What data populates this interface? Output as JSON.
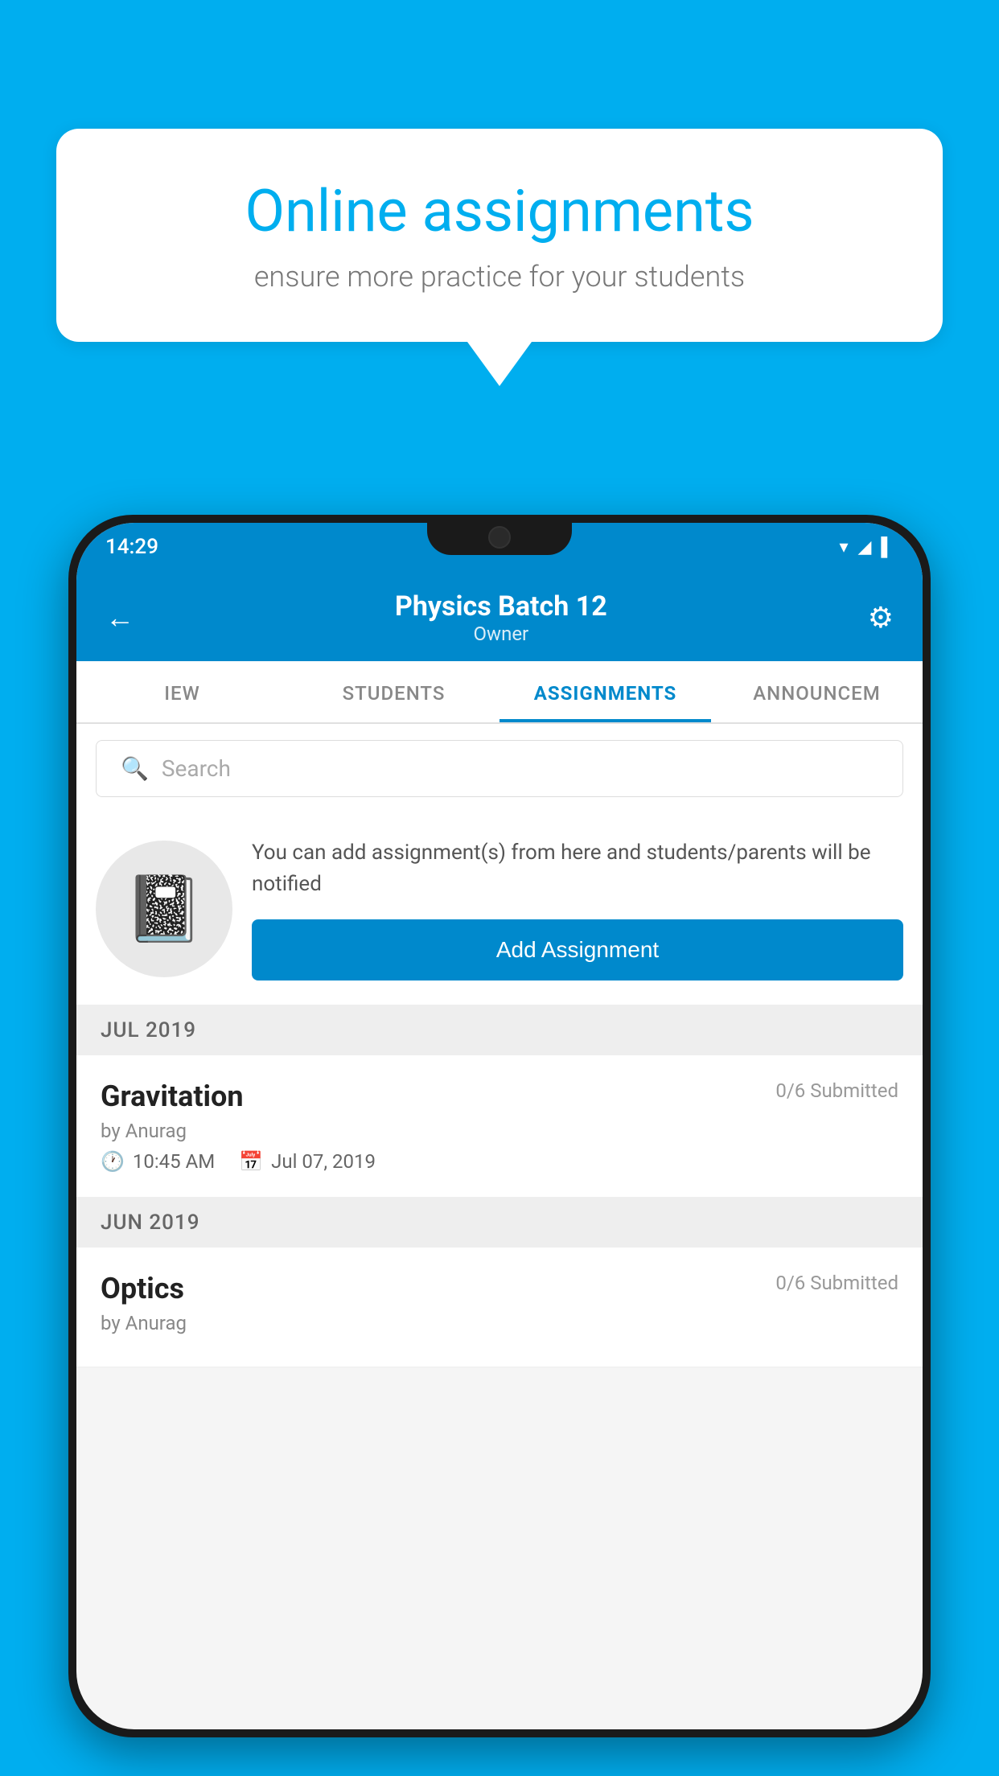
{
  "background": {
    "color": "#00AEEF"
  },
  "speech_bubble": {
    "title": "Online assignments",
    "subtitle": "ensure more practice for your students"
  },
  "status_bar": {
    "time": "14:29",
    "icons": [
      "wifi",
      "signal",
      "battery"
    ]
  },
  "app_header": {
    "title": "Physics Batch 12",
    "subtitle": "Owner",
    "back_label": "←",
    "settings_label": "⚙"
  },
  "tabs": [
    {
      "label": "IEW",
      "active": false
    },
    {
      "label": "STUDENTS",
      "active": false
    },
    {
      "label": "ASSIGNMENTS",
      "active": true
    },
    {
      "label": "ANNOUNCEM",
      "active": false
    }
  ],
  "search": {
    "placeholder": "Search"
  },
  "promo": {
    "description": "You can add assignment(s) from here and students/parents will be notified",
    "button_label": "Add Assignment"
  },
  "assignments": {
    "sections": [
      {
        "month": "JUL 2019",
        "items": [
          {
            "name": "Gravitation",
            "submitted": "0/6 Submitted",
            "by": "by Anurag",
            "time": "10:45 AM",
            "date": "Jul 07, 2019"
          }
        ]
      },
      {
        "month": "JUN 2019",
        "items": [
          {
            "name": "Optics",
            "submitted": "0/6 Submitted",
            "by": "by Anurag",
            "time": "",
            "date": ""
          }
        ]
      }
    ]
  }
}
